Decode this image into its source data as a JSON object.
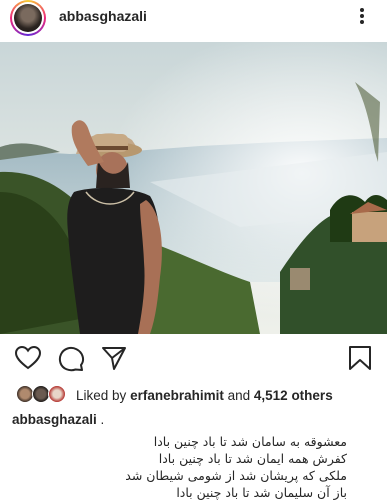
{
  "post": {
    "username": "abbasghazali",
    "more_label": "More options"
  },
  "photo": {
    "alt": "Man in hat looking over sea and green hills"
  },
  "likes": {
    "prefix": "Liked by",
    "user": "erfanebrahimit",
    "middle": "and",
    "count": "4,512 others"
  },
  "caption": {
    "username": "abbasghazali",
    "suffix": ".",
    "lines": [
      "معشوقه به سامان شد تا باد چنین بادا",
      "کفرش همه ایمان شد تا باد چنین بادا",
      "ملکی که پریشان شد از شومی شیطان شد",
      "باز آن سلیمان شد تا باد چنین بادا"
    ]
  },
  "colors": {
    "text": "#262626",
    "sea": "#b9cfd9",
    "sky": "#dfe6e4",
    "hills": "#2f4a22"
  }
}
